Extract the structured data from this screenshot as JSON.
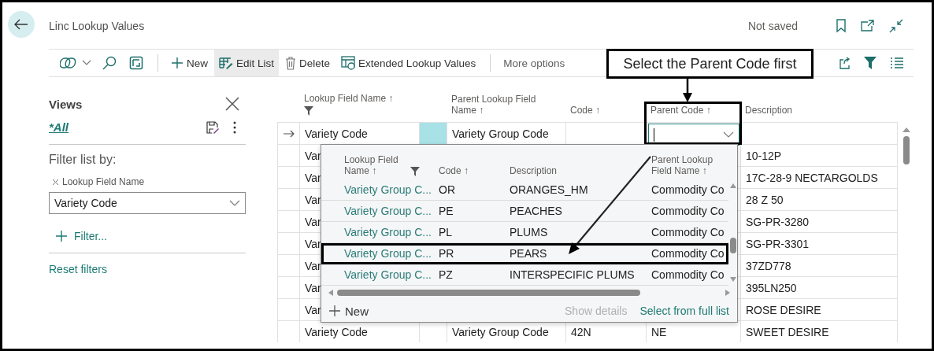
{
  "page": {
    "title": "Linc Lookup Values",
    "status": "Not saved"
  },
  "toolbar": {
    "actions": [
      {
        "label": "New",
        "selected": false
      },
      {
        "label": "Edit List",
        "selected": true
      },
      {
        "label": "Delete",
        "selected": false
      },
      {
        "label": "Extended Lookup Values",
        "selected": false
      }
    ],
    "more": "More options"
  },
  "views": {
    "title": "Views",
    "current_view": "*All"
  },
  "filters": {
    "heading": "Filter list by:",
    "field_label": "Lookup Field Name",
    "value": "Variety Code",
    "add_filter": "Filter...",
    "reset": "Reset filters"
  },
  "table": {
    "columns": [
      {
        "label": "Lookup Field Name ↑",
        "filtered": true,
        "highlighted": false
      },
      {
        "label": "Parent Lookup Field Name ↑",
        "filtered": false,
        "highlighted": false
      },
      {
        "label": "Code ↑",
        "filtered": false,
        "highlighted": false
      },
      {
        "label": "Parent Code ↑",
        "filtered": false,
        "highlighted": true
      },
      {
        "label": "Description",
        "filtered": false,
        "highlighted": false
      }
    ],
    "rows": [
      {
        "current": true,
        "lookup_field_name": "Variety Code",
        "parent_lookup_field_name": "Variety Group Code"
      },
      {
        "current": false,
        "lookup_field_name": "Var",
        "description": "10-12P"
      },
      {
        "current": false,
        "lookup_field_name": "Var",
        "description": "17C-28-9 NECTARGOLDS"
      },
      {
        "current": false,
        "lookup_field_name": "Var",
        "description": "28 Z 50"
      },
      {
        "current": false,
        "lookup_field_name": "Var",
        "description": "SG-PR-3280"
      },
      {
        "current": false,
        "lookup_field_name": "Var",
        "description": "SG-PR-3301"
      },
      {
        "current": false,
        "lookup_field_name": "Var",
        "description": "37ZD778"
      },
      {
        "current": false,
        "lookup_field_name": "Var",
        "description": "395LN250"
      },
      {
        "current": false,
        "lookup_field_name": "Var",
        "description": "ROSE DESIRE"
      },
      {
        "current": false,
        "lookup_field_name": "Variety Code",
        "parent_lookup_field_name": "Variety Group Code",
        "code": "42N",
        "parent_code": "NE",
        "description": "SWEET DESIRE"
      }
    ]
  },
  "lookup": {
    "columns": [
      {
        "label": "Lookup Field Name ↑",
        "filtered": true
      },
      {
        "label": "Code ↑",
        "filtered": false
      },
      {
        "label": "Description",
        "filtered": false
      },
      {
        "label": "Parent Lookup Field Name ↑",
        "filtered": false
      }
    ],
    "rows": [
      {
        "lookup_field_name": "Variety Group C...",
        "code": "OR",
        "description": "ORANGES_HM",
        "parent_lookup_field_name": "Commodity Co",
        "highlighted": false
      },
      {
        "lookup_field_name": "Variety Group C...",
        "code": "PE",
        "description": "PEACHES",
        "parent_lookup_field_name": "Commodity Co",
        "highlighted": false
      },
      {
        "lookup_field_name": "Variety Group C...",
        "code": "PL",
        "description": "PLUMS",
        "parent_lookup_field_name": "Commodity Co",
        "highlighted": false
      },
      {
        "lookup_field_name": "Variety Group C...",
        "code": "PR",
        "description": "PEARS",
        "parent_lookup_field_name": "Commodity Co",
        "highlighted": true
      },
      {
        "lookup_field_name": "Variety Group C...",
        "code": "PZ",
        "description": "INTERSPECIFIC PLUMS",
        "parent_lookup_field_name": "Commodity Co",
        "highlighted": false
      }
    ],
    "new": "New",
    "actions": [
      {
        "label": "Show details",
        "disabled": true
      },
      {
        "label": "Select from full list",
        "disabled": false
      }
    ]
  },
  "annotation": {
    "callout": "Select the Parent Code first"
  }
}
